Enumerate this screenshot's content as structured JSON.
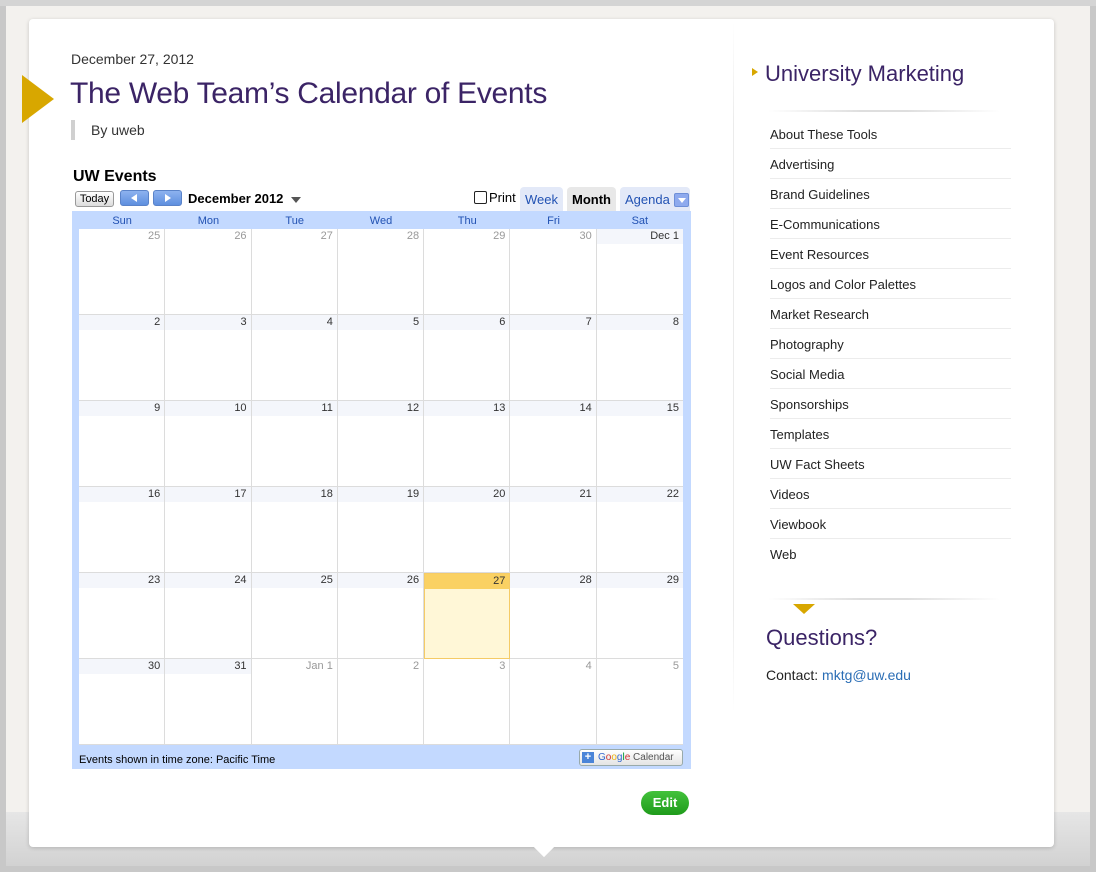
{
  "post": {
    "date": "December 27, 2012",
    "title": "The Web Team’s Calendar of Events",
    "byline": "By uweb",
    "edit_label": "Edit"
  },
  "calendar": {
    "title": "UW Events",
    "today_label": "Today",
    "month_label": "December 2012",
    "print_label": "Print",
    "tabs": [
      "Week",
      "Month",
      "Agenda"
    ],
    "active_tab": "Month",
    "weekdays": [
      "Sun",
      "Mon",
      "Tue",
      "Wed",
      "Thu",
      "Fri",
      "Sat"
    ],
    "weeks": [
      [
        "25",
        "26",
        "27",
        "28",
        "29",
        "30",
        "Dec 1"
      ],
      [
        "2",
        "3",
        "4",
        "5",
        "6",
        "7",
        "8"
      ],
      [
        "9",
        "10",
        "11",
        "12",
        "13",
        "14",
        "15"
      ],
      [
        "16",
        "17",
        "18",
        "19",
        "20",
        "21",
        "22"
      ],
      [
        "23",
        "24",
        "25",
        "26",
        "27",
        "28",
        "29"
      ],
      [
        "30",
        "31",
        "Jan 1",
        "2",
        "3",
        "4",
        "5"
      ]
    ],
    "today": "27",
    "timezone_note": "Events shown in time zone: Pacific Time",
    "gcal_label": "Calendar"
  },
  "sidebar": {
    "heading": "University Marketing",
    "items": [
      "About These Tools",
      "Advertising",
      "Brand Guidelines",
      "E-Communications",
      "Event Resources",
      "Logos and Color Palettes",
      "Market Research",
      "Photography",
      "Social Media",
      "Sponsorships",
      "Templates",
      "UW Fact Sheets",
      "Videos",
      "Viewbook",
      "Web"
    ],
    "questions_heading": "Questions?",
    "contact_label": "Contact:",
    "contact_email": "mktg@uw.edu"
  },
  "colors": {
    "accent_gold": "#d8a700",
    "title_purple": "#3b2466",
    "calendar_blue": "#c3d9ff",
    "today_yellow": "#fad163",
    "edit_green": "#1f9b1b",
    "link_blue": "#2a6db5"
  }
}
